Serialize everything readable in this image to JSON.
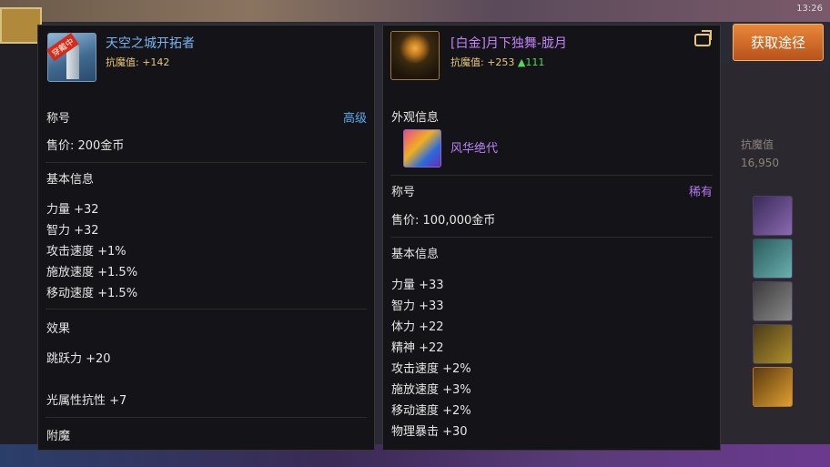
{
  "clock": "13:26",
  "left_item": {
    "icon": "tower-icon",
    "badge": "穿戴中",
    "title": "天空之城开拓者",
    "resist": "抗魔值: +142",
    "category": "称号",
    "grade": "高级",
    "price": "售价: 200金币",
    "basic_heading": "基本信息",
    "stats": [
      "力量 +32",
      "智力 +32",
      "攻击速度 +1%",
      "施放速度 +1.5%",
      "移动速度 +1.5%"
    ],
    "effect_heading": "效果",
    "effects": [
      "跳跃力 +20",
      "光属性抗性 +7"
    ],
    "enchant_heading": "附魔"
  },
  "right_item": {
    "icon": "moon-icon",
    "title": "[白金]月下独舞-胧月",
    "resist": "抗魔值: +253",
    "resist_up": "▲111",
    "appearance_heading": "外观信息",
    "appearance_item": "风华绝代",
    "category": "称号",
    "grade": "稀有",
    "price": "售价: 100,000金币",
    "basic_heading": "基本信息",
    "stats": [
      "力量 +33",
      "智力 +33",
      "体力 +22",
      "精神 +22",
      "攻击速度 +2%",
      "施放速度 +3%",
      "移动速度 +2%",
      "物理暴击 +30"
    ]
  },
  "side": {
    "get_button": "获取途径",
    "resist_label": "抗魔值",
    "resist_value": "16,950"
  },
  "colors": {
    "grade_advanced": "#59a9e8",
    "grade_rare": "#b077ee",
    "title_blue": "#79b3f0",
    "title_purple": "#c084f5",
    "resist_gold": "#e8c978",
    "up_green": "#55d85a"
  }
}
